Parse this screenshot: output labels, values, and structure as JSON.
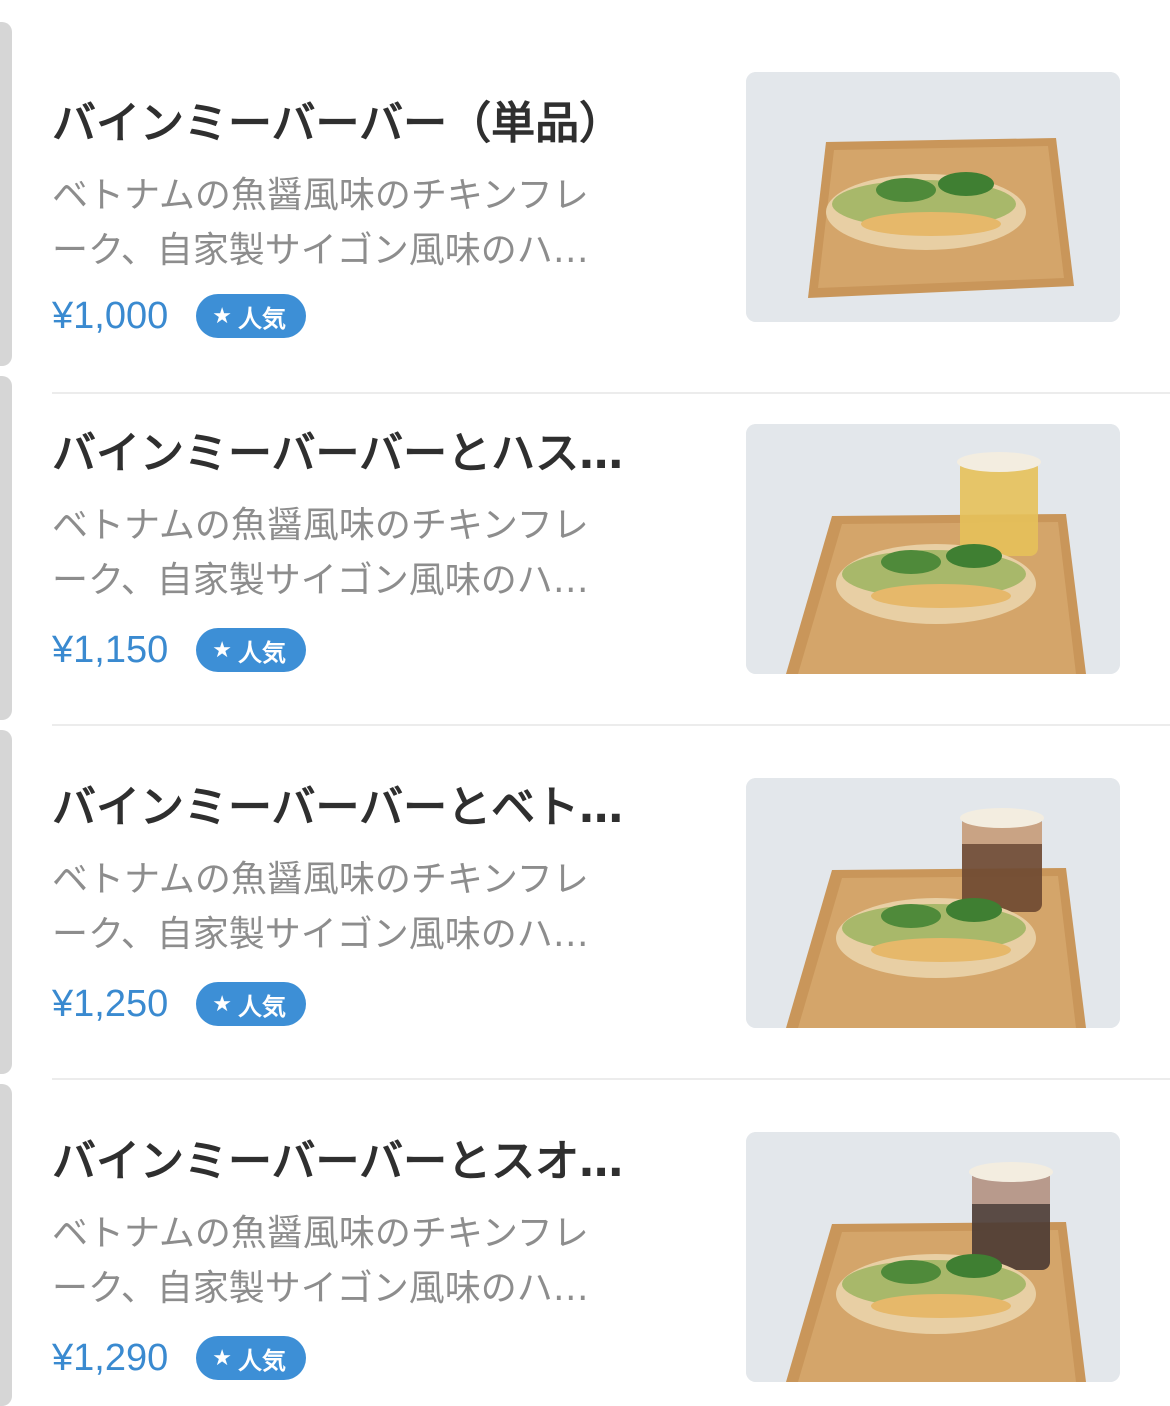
{
  "items": [
    {
      "title": "バインミーバーバー（単品）",
      "desc_line1": "ベトナムの魚醤風味のチキンフレ",
      "desc_line2": "ーク、自家製サイゴン風味のハ…",
      "price": "¥1,000",
      "badge": "人気",
      "drink": "none"
    },
    {
      "title": "バインミーバーバーとハス…",
      "desc_line1": "ベトナムの魚醤風味のチキンフレ",
      "desc_line2": "ーク、自家製サイゴン風味のハ…",
      "price": "¥1,150",
      "badge": "人気",
      "drink": "tea"
    },
    {
      "title": "バインミーバーバーとベト…",
      "desc_line1": "ベトナムの魚醤風味のチキンフレ",
      "desc_line2": "ーク、自家製サイゴン風味のハ…",
      "price": "¥1,250",
      "badge": "人気",
      "drink": "coffee"
    },
    {
      "title": "バインミーバーバーとスオ…",
      "desc_line1": "ベトナムの魚醤風味のチキンフレ",
      "desc_line2": "ーク、自家製サイゴン風味のハ…",
      "price": "¥1,290",
      "badge": "人気",
      "drink": "jelly-coffee"
    }
  ],
  "colors": {
    "price": "#3a8ad0",
    "badge_bg": "#3d8fd6",
    "title": "#2f2f2f",
    "desc": "#8d8d8d"
  },
  "icons": {
    "badge_icon": "star-icon"
  }
}
